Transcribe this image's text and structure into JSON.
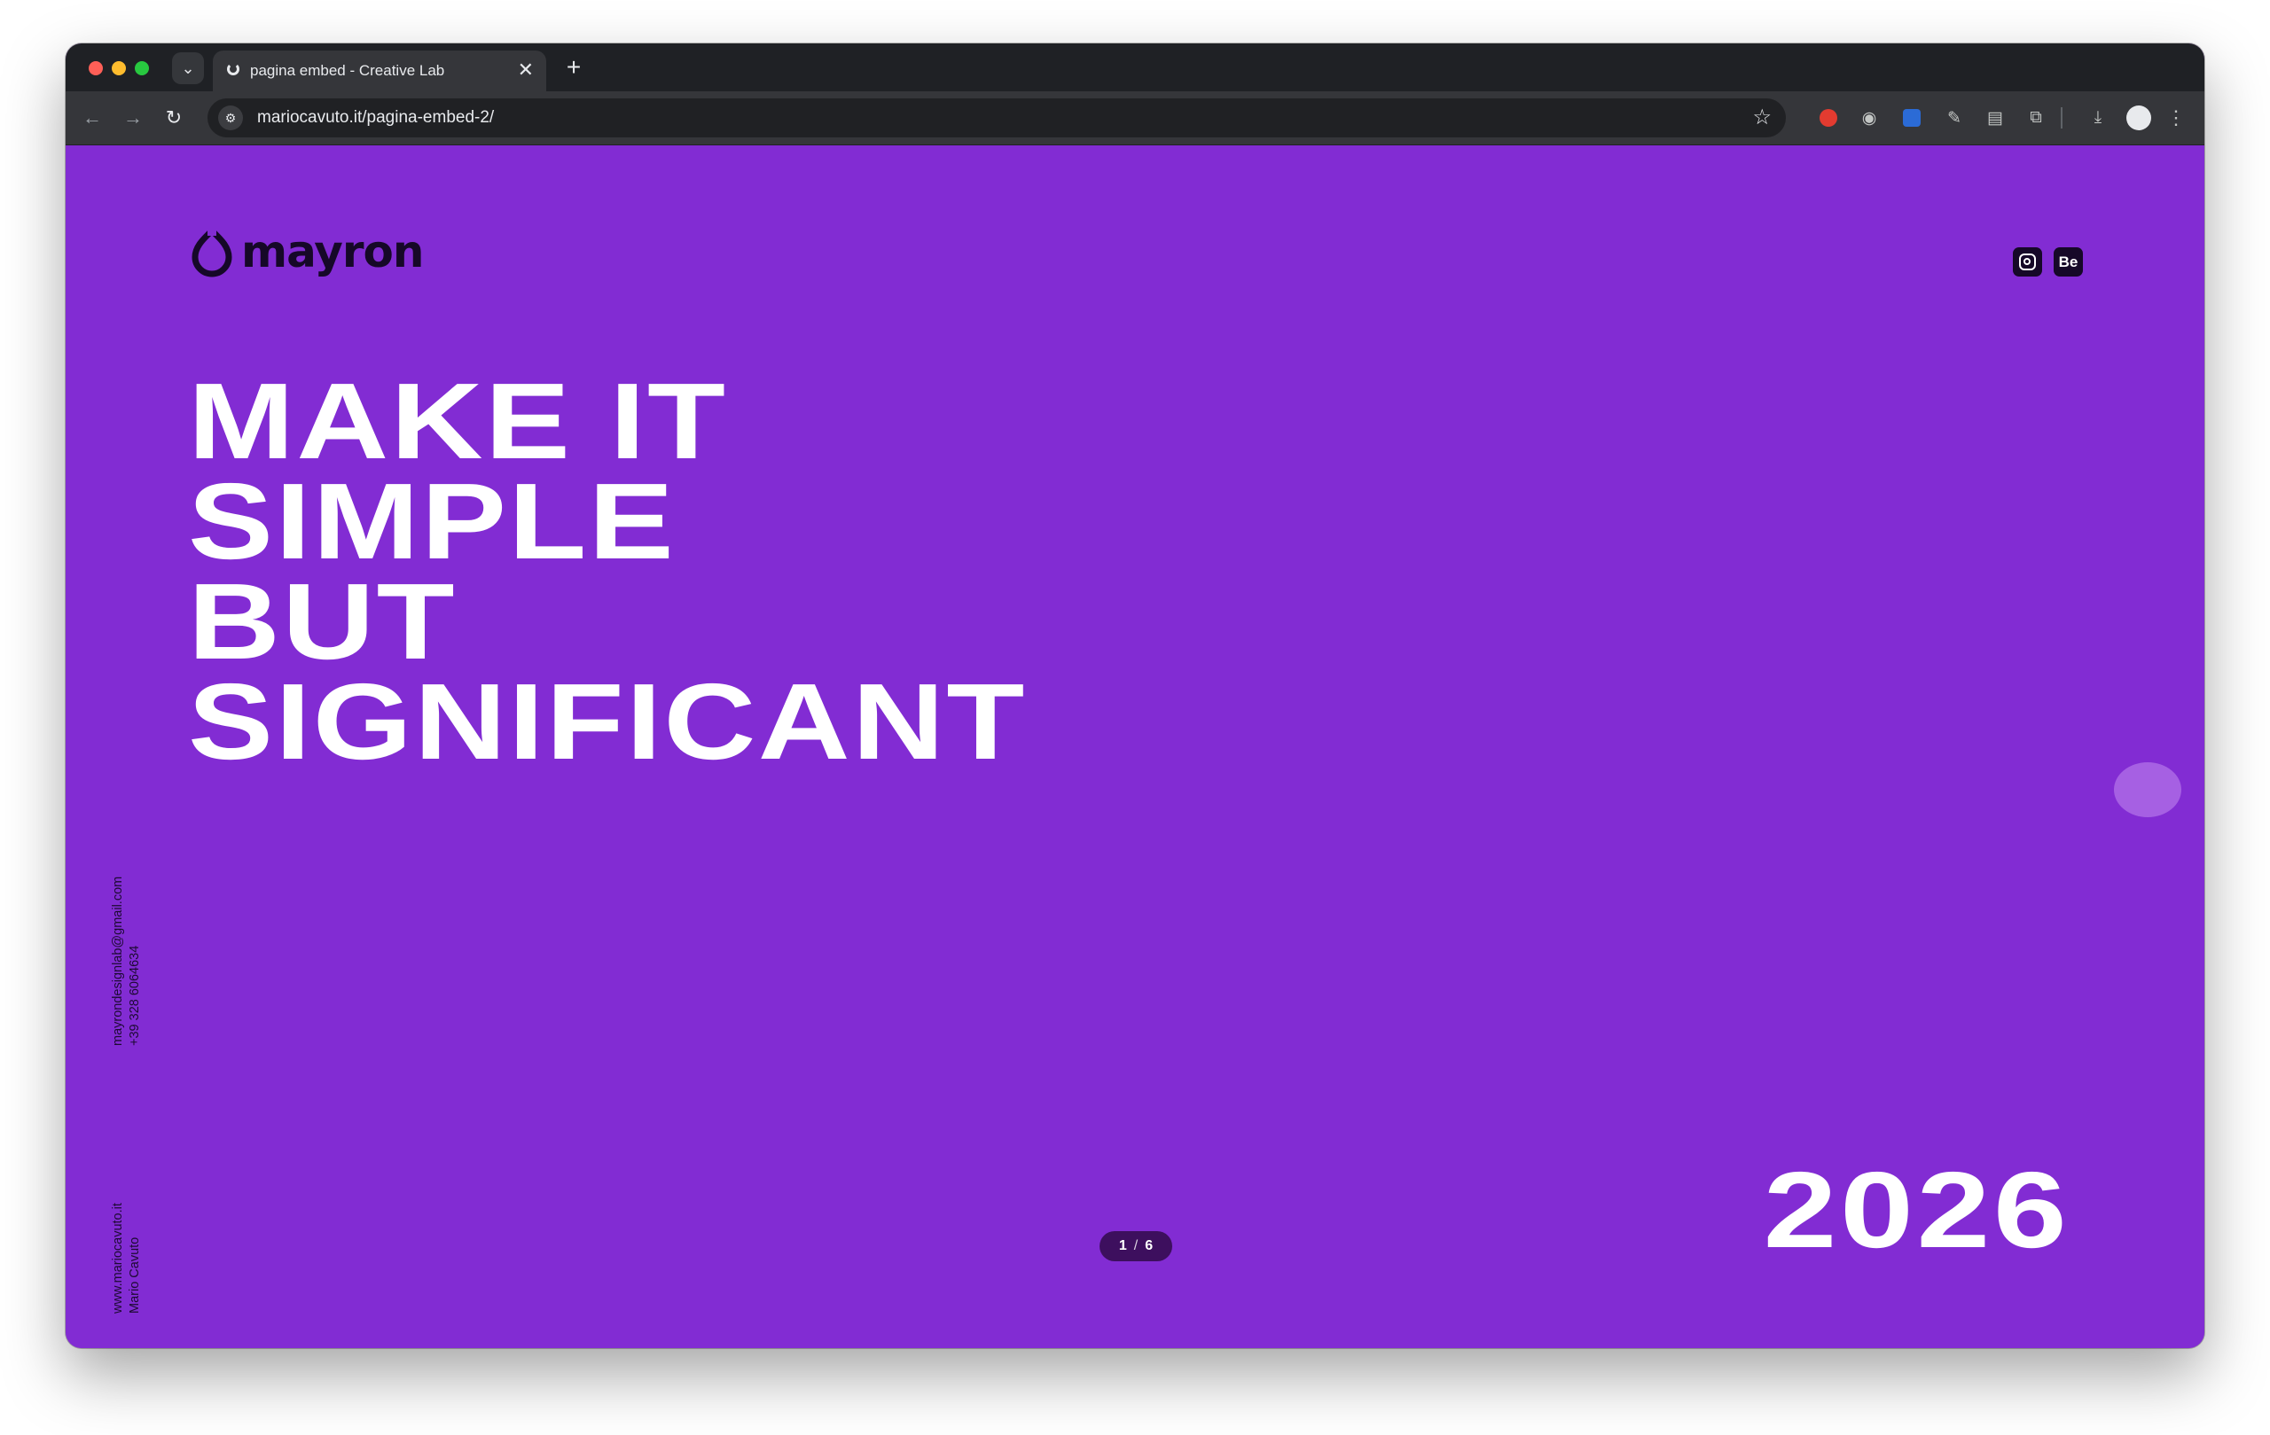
{
  "browser": {
    "tab_title": "pagina embed - Creative Lab",
    "tab_close": "✕",
    "new_tab": "+",
    "url": "mariocavuto.it/pagina-embed-2/"
  },
  "page": {
    "logo_text": "mayron",
    "social": {
      "instagram": "instagram-icon",
      "behance_label": "Be"
    },
    "headline": [
      "MAKE IT",
      "SIMPLE",
      "BUT",
      "SIGNIFICANT"
    ],
    "contact_phone": "+39 328 6064634",
    "contact_email": "mayrondesignlab@gmail.com",
    "credit_name": "Mario Cavuto",
    "credit_site": "www.mariocavuto.it",
    "year": "2026",
    "pager": {
      "current": "1",
      "separator": "/",
      "total": "6"
    }
  },
  "colors": {
    "background": "#822cd3",
    "text": "#ffffff",
    "dark": "#160828"
  }
}
